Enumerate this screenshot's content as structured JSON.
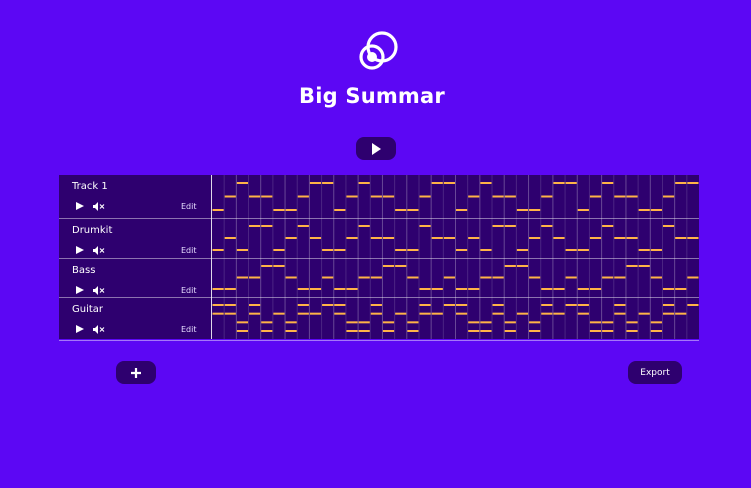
{
  "app": {
    "title": "Big Summar",
    "logo_icon": "interlocking-circles-logo",
    "accent_color": "#5c07f4",
    "panel_color": "#2e006f",
    "note_color": "#ffb347"
  },
  "transport": {
    "play_icon": "play-icon"
  },
  "tracks": [
    {
      "name": "Track 1",
      "edit_label": "Edit",
      "note_lanes": 3,
      "notes": [
        [
          0,
          0
        ],
        [
          1,
          1
        ],
        [
          2,
          2
        ],
        [
          3,
          1
        ],
        [
          4,
          1
        ],
        [
          5,
          0
        ],
        [
          6,
          0
        ],
        [
          7,
          1
        ],
        [
          8,
          2
        ],
        [
          9,
          2
        ],
        [
          10,
          0
        ],
        [
          11,
          1
        ],
        [
          12,
          2
        ],
        [
          13,
          1
        ],
        [
          14,
          1
        ],
        [
          15,
          0
        ],
        [
          16,
          0
        ],
        [
          17,
          1
        ],
        [
          18,
          2
        ],
        [
          19,
          2
        ],
        [
          20,
          0
        ],
        [
          21,
          1
        ],
        [
          22,
          2
        ],
        [
          23,
          1
        ],
        [
          24,
          1
        ],
        [
          25,
          0
        ],
        [
          26,
          0
        ],
        [
          27,
          1
        ],
        [
          28,
          2
        ],
        [
          29,
          2
        ],
        [
          30,
          0
        ],
        [
          31,
          1
        ],
        [
          32,
          2
        ],
        [
          33,
          1
        ],
        [
          34,
          1
        ],
        [
          35,
          0
        ],
        [
          36,
          0
        ],
        [
          37,
          1
        ],
        [
          38,
          2
        ],
        [
          39,
          2
        ]
      ]
    },
    {
      "name": "Drumkit",
      "edit_label": "Edit",
      "note_lanes": 3,
      "notes": [
        [
          0,
          0
        ],
        [
          1,
          1
        ],
        [
          2,
          0
        ],
        [
          3,
          2
        ],
        [
          4,
          2
        ],
        [
          5,
          0
        ],
        [
          6,
          1
        ],
        [
          7,
          2
        ],
        [
          8,
          1
        ],
        [
          9,
          0
        ],
        [
          10,
          0
        ],
        [
          11,
          1
        ],
        [
          12,
          2
        ],
        [
          13,
          1
        ],
        [
          14,
          1
        ],
        [
          15,
          0
        ],
        [
          16,
          0
        ],
        [
          17,
          2
        ],
        [
          18,
          1
        ],
        [
          19,
          1
        ],
        [
          20,
          0
        ],
        [
          21,
          1
        ],
        [
          22,
          0
        ],
        [
          23,
          2
        ],
        [
          24,
          2
        ],
        [
          25,
          0
        ],
        [
          26,
          1
        ],
        [
          27,
          2
        ],
        [
          28,
          1
        ],
        [
          29,
          0
        ],
        [
          30,
          0
        ],
        [
          31,
          1
        ],
        [
          32,
          2
        ],
        [
          33,
          1
        ],
        [
          34,
          1
        ],
        [
          35,
          0
        ],
        [
          36,
          0
        ],
        [
          37,
          2
        ],
        [
          38,
          1
        ],
        [
          39,
          1
        ]
      ]
    },
    {
      "name": "Bass",
      "edit_label": "Edit",
      "note_lanes": 3,
      "notes": [
        [
          0,
          0
        ],
        [
          1,
          0
        ],
        [
          2,
          1
        ],
        [
          3,
          1
        ],
        [
          4,
          2
        ],
        [
          5,
          2
        ],
        [
          6,
          1
        ],
        [
          7,
          0
        ],
        [
          8,
          0
        ],
        [
          9,
          1
        ],
        [
          10,
          0
        ],
        [
          11,
          0
        ],
        [
          12,
          1
        ],
        [
          13,
          1
        ],
        [
          14,
          2
        ],
        [
          15,
          2
        ],
        [
          16,
          1
        ],
        [
          17,
          0
        ],
        [
          18,
          0
        ],
        [
          19,
          1
        ],
        [
          20,
          0
        ],
        [
          21,
          0
        ],
        [
          22,
          1
        ],
        [
          23,
          1
        ],
        [
          24,
          2
        ],
        [
          25,
          2
        ],
        [
          26,
          1
        ],
        [
          27,
          0
        ],
        [
          28,
          0
        ],
        [
          29,
          1
        ],
        [
          30,
          0
        ],
        [
          31,
          0
        ],
        [
          32,
          1
        ],
        [
          33,
          1
        ],
        [
          34,
          2
        ],
        [
          35,
          2
        ],
        [
          36,
          1
        ],
        [
          37,
          0
        ],
        [
          38,
          0
        ],
        [
          39,
          1
        ]
      ]
    },
    {
      "name": "Guitar",
      "edit_label": "Edit",
      "note_lanes": 4,
      "notes": [
        [
          0,
          3
        ],
        [
          0,
          2
        ],
        [
          1,
          3
        ],
        [
          1,
          2
        ],
        [
          2,
          1
        ],
        [
          2,
          0
        ],
        [
          3,
          3
        ],
        [
          3,
          2
        ],
        [
          4,
          1
        ],
        [
          4,
          0
        ],
        [
          5,
          2
        ],
        [
          6,
          1
        ],
        [
          6,
          0
        ],
        [
          7,
          3
        ],
        [
          7,
          2
        ],
        [
          8,
          2
        ],
        [
          9,
          3
        ],
        [
          10,
          3
        ],
        [
          10,
          2
        ],
        [
          11,
          1
        ],
        [
          11,
          0
        ],
        [
          12,
          1
        ],
        [
          12,
          0
        ],
        [
          13,
          3
        ],
        [
          13,
          2
        ],
        [
          14,
          1
        ],
        [
          14,
          0
        ],
        [
          15,
          2
        ],
        [
          16,
          1
        ],
        [
          16,
          0
        ],
        [
          17,
          3
        ],
        [
          17,
          2
        ],
        [
          18,
          2
        ],
        [
          19,
          3
        ],
        [
          20,
          3
        ],
        [
          20,
          2
        ],
        [
          21,
          1
        ],
        [
          21,
          0
        ],
        [
          22,
          1
        ],
        [
          22,
          0
        ],
        [
          23,
          3
        ],
        [
          23,
          2
        ],
        [
          24,
          1
        ],
        [
          24,
          0
        ],
        [
          25,
          2
        ],
        [
          26,
          1
        ],
        [
          26,
          0
        ],
        [
          27,
          3
        ],
        [
          27,
          2
        ],
        [
          28,
          2
        ],
        [
          29,
          3
        ],
        [
          30,
          3
        ],
        [
          30,
          2
        ],
        [
          31,
          1
        ],
        [
          31,
          0
        ],
        [
          32,
          1
        ],
        [
          32,
          0
        ],
        [
          33,
          3
        ],
        [
          33,
          2
        ],
        [
          34,
          1
        ],
        [
          34,
          0
        ],
        [
          35,
          2
        ],
        [
          36,
          1
        ],
        [
          36,
          0
        ],
        [
          37,
          3
        ],
        [
          37,
          2
        ],
        [
          38,
          2
        ],
        [
          39,
          3
        ]
      ]
    }
  ],
  "toolbar": {
    "add_icon": "plus-icon",
    "export_label": "Export"
  }
}
